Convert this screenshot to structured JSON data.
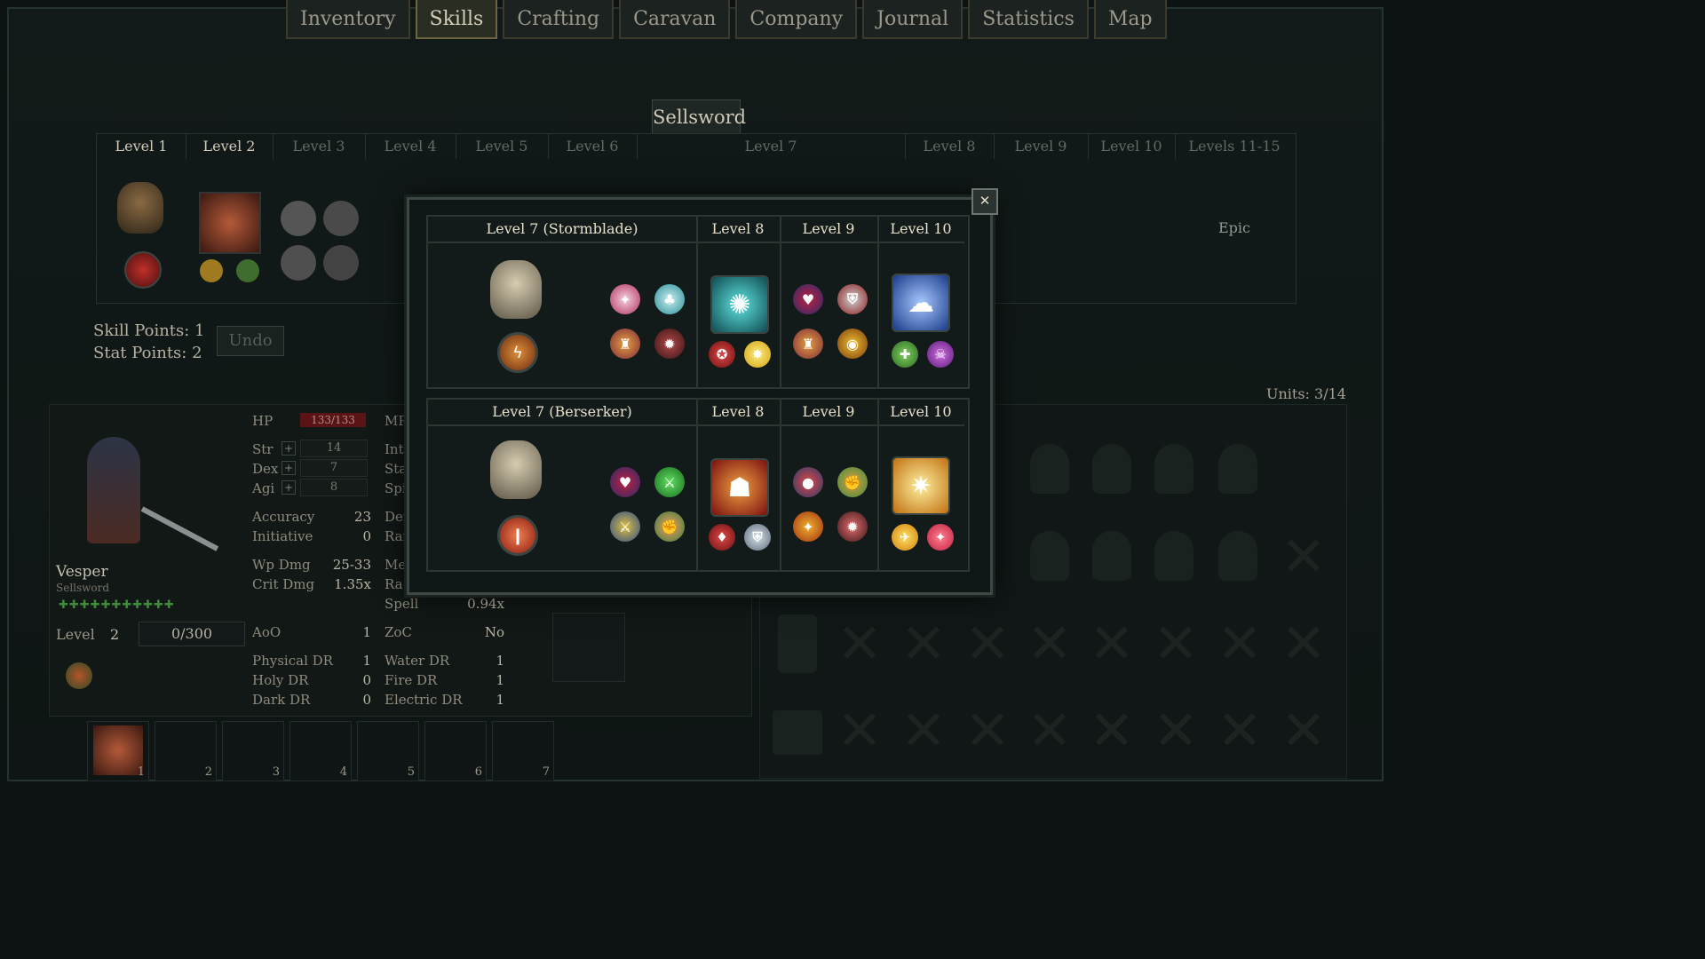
{
  "tabs": [
    "Inventory",
    "Skills",
    "Crafting",
    "Caravan",
    "Company",
    "Journal",
    "Statistics",
    "Map"
  ],
  "active_tab": "Skills",
  "class_title": "Sellsword",
  "levels": [
    "Level 1",
    "Level 2",
    "Level 3",
    "Level 4",
    "Level 5",
    "Level 6",
    "Level 7",
    "Level 8",
    "Level 9",
    "Level 10",
    "Levels 11-15"
  ],
  "epic_label": "Epic",
  "skill_points": "Skill Points: 1",
  "stat_points": "Stat Points: 2",
  "undo_label": "Undo",
  "units": "Units: 3/14",
  "character": {
    "name": "Vesper",
    "class": "Sellsword",
    "level_label": "Level",
    "level": "2",
    "xp": "0/300",
    "hp_label": "HP",
    "hp": "133/133",
    "mp_label": "MP",
    "str_label": "Str",
    "str": "14",
    "dex_label": "Dex",
    "dex": "7",
    "agi_label": "Agi",
    "agi": "8",
    "int_label": "Int",
    "sta_label": "Sta",
    "spi_label": "Spi",
    "accuracy_label": "Accuracy",
    "accuracy": "23",
    "initiative_label": "Initiative",
    "initiative": "0",
    "def_label": "Def",
    "ran_label": "Rar",
    "wpdmg_label": "Wp Dmg",
    "wpdmg": "25-33",
    "critdmg_label": "Crit Dmg",
    "critdmg": "1.35x",
    "me_label": "Me",
    "ra_label": "Ra",
    "spell_label": "Spell",
    "spell": "0.94x",
    "aoo_label": "AoO",
    "aoo": "1",
    "zoc_label": "ZoC",
    "zoc": "No",
    "physdr_label": "Physical DR",
    "physdr": "1",
    "holydr_label": "Holy DR",
    "holydr": "0",
    "darkdr_label": "Dark DR",
    "darkdr": "0",
    "waterdr_label": "Water DR",
    "waterdr": "1",
    "firedr_label": "Fire DR",
    "firedr": "1",
    "elecdr_label": "Electric DR",
    "elecdr": "1"
  },
  "hotbar": [
    "1",
    "2",
    "3",
    "4",
    "5",
    "6",
    "7"
  ],
  "modal": {
    "close_icon": "✕",
    "stormblade": {
      "title": "Level 7 (Stormblade)",
      "l8": "Level 8",
      "l9": "Level 9",
      "l10": "Level 10"
    },
    "berserker": {
      "title": "Level 7 (Berserker)",
      "l8": "Level 8",
      "l9": "Level 9",
      "l10": "Level 10"
    }
  },
  "colors": {
    "accent_gold": "#d2cdb8",
    "hp_red": "#5a1416",
    "panel_bg": "#121b1a"
  }
}
